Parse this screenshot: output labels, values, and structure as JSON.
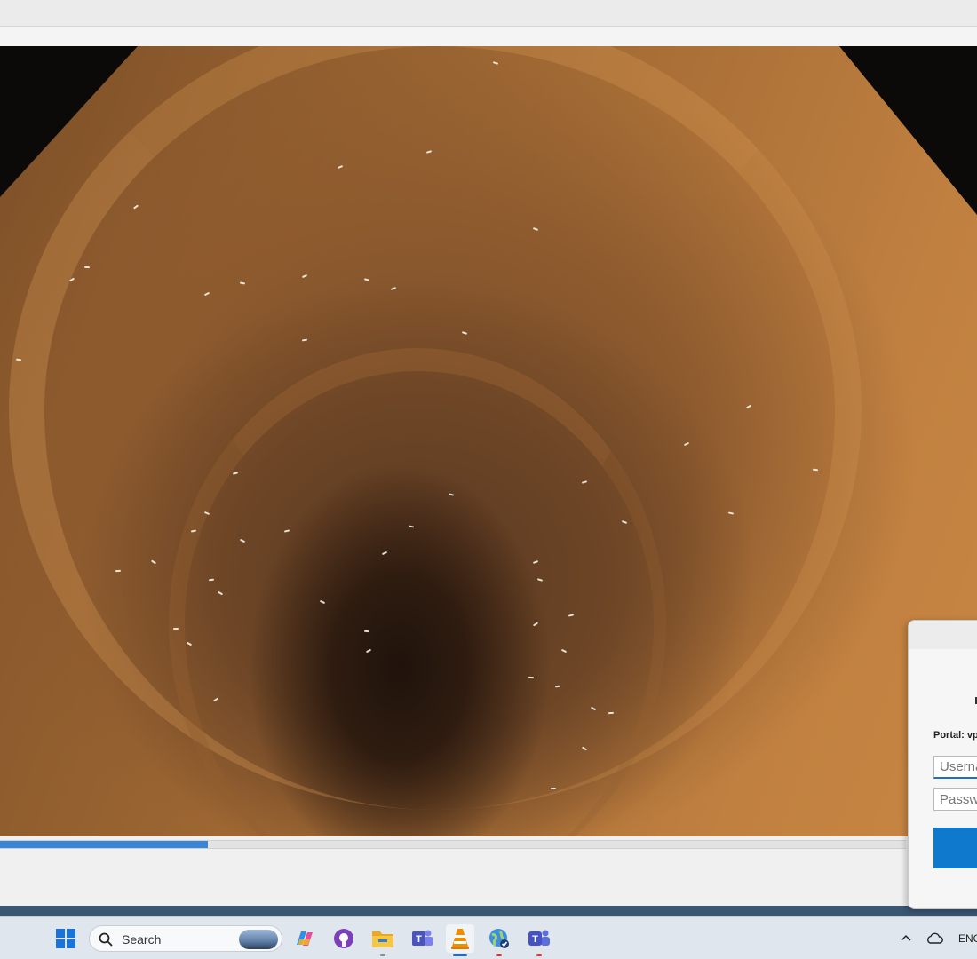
{
  "video": {
    "progress_fraction": 0.229
  },
  "vpn_dialog": {
    "portal_label": "Portal: vp",
    "username_placeholder": "Userna",
    "password_placeholder": "Passwo"
  },
  "taskbar": {
    "search_label": "Search",
    "language_indicator": "ENG",
    "apps": [
      "windows-start-icon",
      "copilot-icon",
      "github-desktop-icon",
      "file-explorer-icon",
      "teams-icon",
      "vlc-icon",
      "globe-vpn-icon",
      "teams-new-icon"
    ]
  },
  "colors": {
    "accent": "#0f7acd",
    "progress": "#3a86d6"
  }
}
